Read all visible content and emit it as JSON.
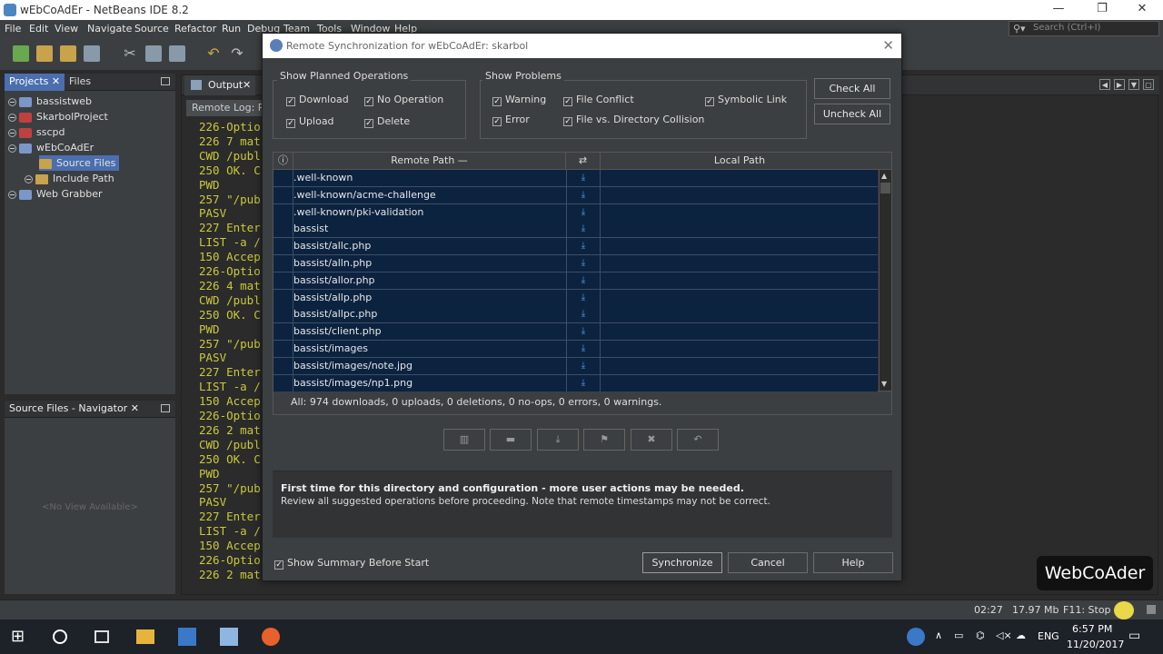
{
  "window": {
    "title": "wEbCoAdEr - NetBeans IDE 8.2"
  },
  "menu": {
    "items": [
      "File",
      "Edit",
      "View",
      "Navigate",
      "Source",
      "Refactor",
      "Run",
      "Debug",
      "Team",
      "Tools",
      "Window",
      "Help"
    ]
  },
  "search": {
    "placeholder": "Search (Ctrl+I)"
  },
  "projects_panel": {
    "tabs": [
      "Projects",
      "Files"
    ],
    "tree": [
      "bassistweb",
      "SkarbolProject",
      "sscpd",
      "wEbCoAdEr",
      "Source Files",
      "Include Path",
      "Web Grabber"
    ]
  },
  "navigator": {
    "title": "Source Files - Navigator",
    "empty": "<No View Available>"
  },
  "output": {
    "tab": "Output",
    "subtab": "Remote Log: R",
    "lines": [
      "226-Optio",
      "226 7 mat",
      "CWD /publ",
      "250 OK. C",
      "PWD",
      "257 \"/pub",
      "PASV",
      "227 Enter",
      "LIST -a /",
      "150 Accep",
      "226-Optio",
      "226 4 mat",
      "CWD /publ",
      "250 OK. C",
      "PWD",
      "257 \"/pub",
      "PASV",
      "227 Enter",
      "LIST -a /",
      "150 Accep",
      "226-Optio",
      "226 2 mat",
      "CWD /publ",
      "250 OK. C",
      "PWD",
      "257 \"/pub",
      "PASV",
      "227 Enter",
      "LIST -a /",
      "150 Accep",
      "226-Optio",
      "226 2 mat"
    ]
  },
  "dialog": {
    "title": "Remote Synchronization for wEbCoAdEr: skarbol",
    "planned_label": "Show Planned Operations",
    "planned": [
      "Download",
      "No Operation",
      "Upload",
      "Delete"
    ],
    "problems_label": "Show Problems",
    "problems": [
      "Warning",
      "File Conflict",
      "Symbolic Link",
      "Error",
      "File vs. Directory Collision"
    ],
    "check_all": "Check All",
    "uncheck_all": "Uncheck All",
    "col_remote": "Remote Path —",
    "col_local": "Local Path",
    "rows": [
      ".well-known",
      ".well-known/acme-challenge",
      ".well-known/pki-validation",
      "bassist",
      "bassist/allc.php",
      "bassist/alln.php",
      "bassist/allor.php",
      "bassist/allp.php",
      "bassist/allpc.php",
      "bassist/client.php",
      "bassist/images",
      "bassist/images/note.jpg",
      "bassist/images/np1.png"
    ],
    "summary": "All: 974 downloads, 0 uploads, 0 deletions, 0 no-ops, 0 errors, 0 warnings.",
    "msg_title": "First time for this directory and configuration - more user actions may be needed.",
    "msg_body": "Review all suggested operations before proceeding. Note that remote timestamps may not be correct.",
    "show_summary": "Show Summary Before Start",
    "synchronize": "Synchronize",
    "cancel": "Cancel",
    "help": "Help"
  },
  "status": {
    "time": "02:27",
    "memory": "17.97 Mb",
    "stop": "F11: Stop"
  },
  "taskbar": {
    "lang": "ENG",
    "clock_time": "6:57 PM",
    "clock_date": "11/20/2017"
  },
  "watermark": "WebCoAder"
}
